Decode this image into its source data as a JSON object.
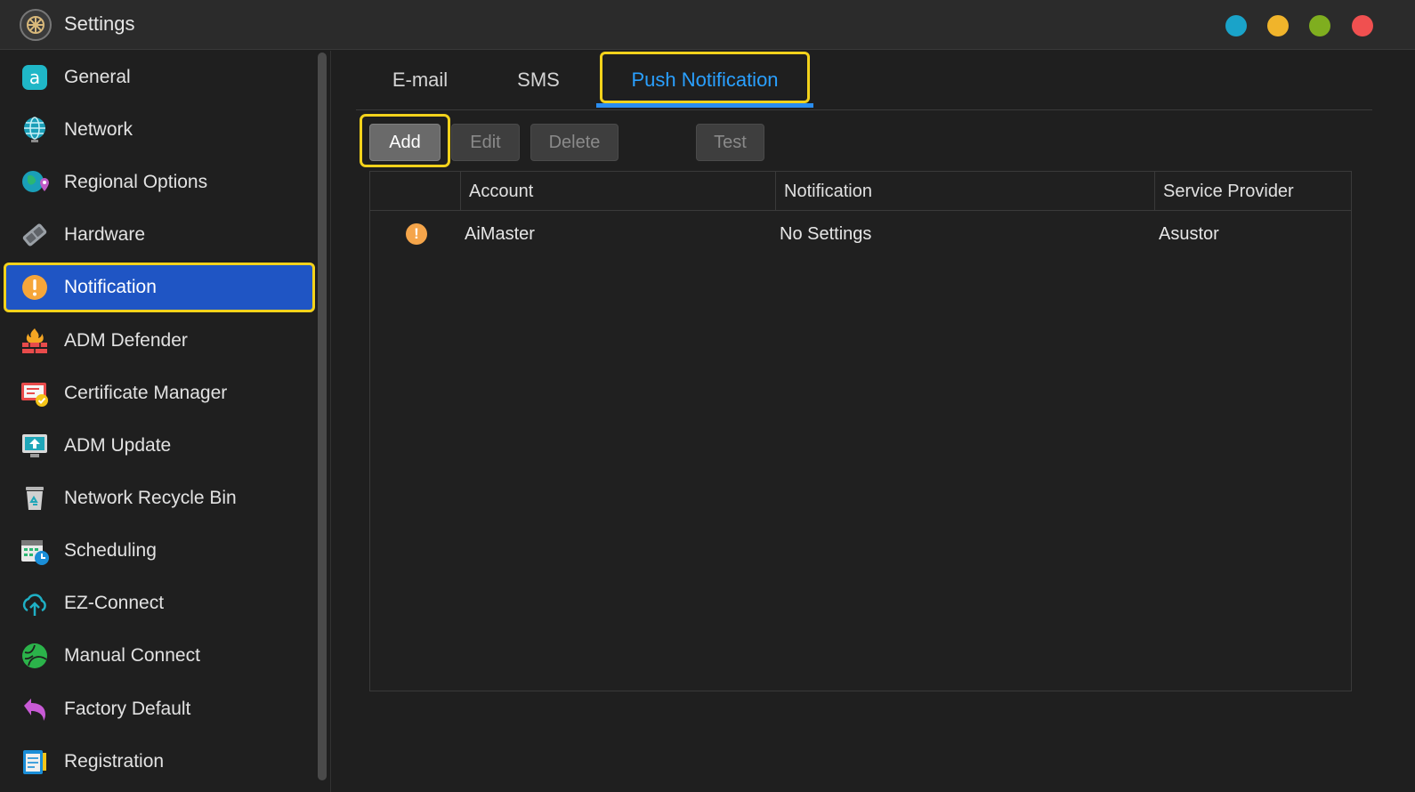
{
  "app": {
    "title": "Settings"
  },
  "window_controls": [
    {
      "name": "window-dot-blue",
      "color": "#1aa3c9"
    },
    {
      "name": "window-dot-yellow",
      "color": "#f0b42b"
    },
    {
      "name": "window-dot-green",
      "color": "#7fae1f"
    },
    {
      "name": "window-dot-red",
      "color": "#f05050"
    }
  ],
  "sidebar": {
    "items": [
      {
        "label": "General",
        "icon": "general-icon"
      },
      {
        "label": "Network",
        "icon": "globe-icon"
      },
      {
        "label": "Regional Options",
        "icon": "regional-globe-icon"
      },
      {
        "label": "Hardware",
        "icon": "hardware-icon"
      },
      {
        "label": "Notification",
        "icon": "alert-icon",
        "active": true
      },
      {
        "label": "ADM Defender",
        "icon": "firewall-icon"
      },
      {
        "label": "Certificate Manager",
        "icon": "certificate-icon"
      },
      {
        "label": "ADM Update",
        "icon": "update-icon"
      },
      {
        "label": "Network Recycle Bin",
        "icon": "recycle-bin-icon"
      },
      {
        "label": "Scheduling",
        "icon": "calendar-clock-icon"
      },
      {
        "label": "EZ-Connect",
        "icon": "cloud-upload-icon"
      },
      {
        "label": "Manual Connect",
        "icon": "manual-connect-icon"
      },
      {
        "label": "Factory Default",
        "icon": "undo-icon"
      },
      {
        "label": "Registration",
        "icon": "registration-icon"
      }
    ]
  },
  "tabs": [
    {
      "label": "E-mail"
    },
    {
      "label": "SMS"
    },
    {
      "label": "Push Notification",
      "active": true
    }
  ],
  "toolbar": {
    "add_label": "Add",
    "edit_label": "Edit",
    "delete_label": "Delete",
    "test_label": "Test"
  },
  "table": {
    "columns": [
      "",
      "Account",
      "Notification",
      "Service Provider"
    ],
    "rows": [
      {
        "status_icon": "warning-icon",
        "account": "AiMaster",
        "notification": "No Settings",
        "provider": "Asustor"
      }
    ]
  },
  "colors": {
    "accent_blue": "#2a8df0",
    "active_nav": "#1f55c4",
    "highlight": "#f3d21b",
    "warning": "#f5a54a"
  }
}
